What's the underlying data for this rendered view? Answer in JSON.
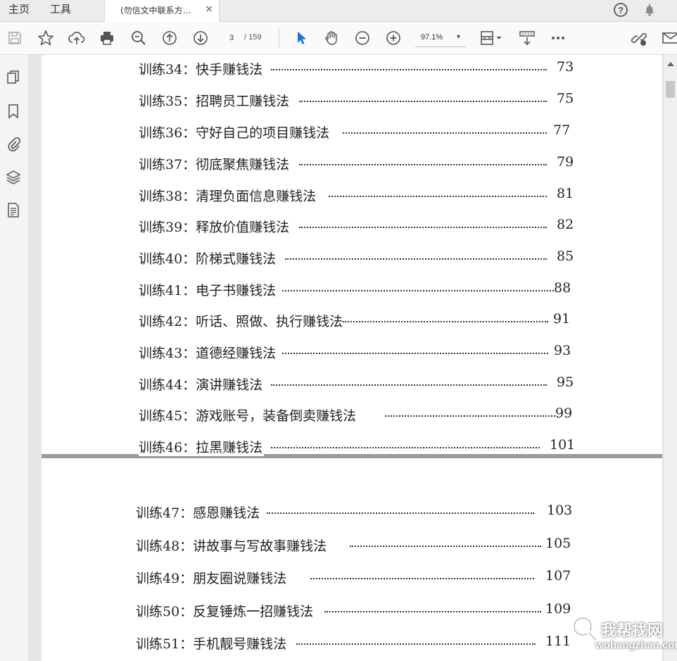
{
  "tabbar": {
    "home_label": "主页",
    "tools_label": "工具",
    "document_tab_title": "(勿信文中联系方…",
    "close_glyph": "×"
  },
  "toolbar": {
    "current_page": "3",
    "total_pages": "/ 159",
    "zoom": "97.1%",
    "accent_color": "#1473e6"
  },
  "toc": {
    "page1": [
      {
        "title": "训练34：快手赚钱法",
        "page": "73"
      },
      {
        "title": "训练35：招聘员工赚钱法",
        "page": "75"
      },
      {
        "title": "训练36：守好自己的项目赚钱法",
        "page": "77"
      },
      {
        "title": "训练37：彻底聚焦赚钱法",
        "page": "79"
      },
      {
        "title": "训练38：清理负面信息赚钱法",
        "page": "81"
      },
      {
        "title": "训练39：释放价值赚钱法",
        "page": "82"
      },
      {
        "title": "训练40：阶梯式赚钱法",
        "page": "85"
      },
      {
        "title": "训练41：电子书赚钱法",
        "page": "88"
      },
      {
        "title": "训练42：听话、照做、执行赚钱法",
        "page": "91"
      },
      {
        "title": "训练43：道德经赚钱法",
        "page": "93"
      },
      {
        "title": "训练44：演讲赚钱法",
        "page": "95"
      },
      {
        "title": "训练45：游戏账号，装备倒卖赚钱法",
        "page": "99"
      },
      {
        "title": "训练46：拉黑赚钱法",
        "page": "101"
      }
    ],
    "page2": [
      {
        "title": "训练47：感恩赚钱法",
        "page": "103"
      },
      {
        "title": "训练48：讲故事与写故事赚钱法",
        "page": "105"
      },
      {
        "title": "训练49：朋友圈说赚钱法",
        "page": "107"
      },
      {
        "title": "训练50：反复锤炼一招赚钱法",
        "page": "109"
      },
      {
        "title": "训练51：手机靓号赚钱法",
        "page": "111"
      }
    ]
  },
  "watermark": {
    "cn": "我帮找网",
    "en": "wobangzhao.com"
  }
}
